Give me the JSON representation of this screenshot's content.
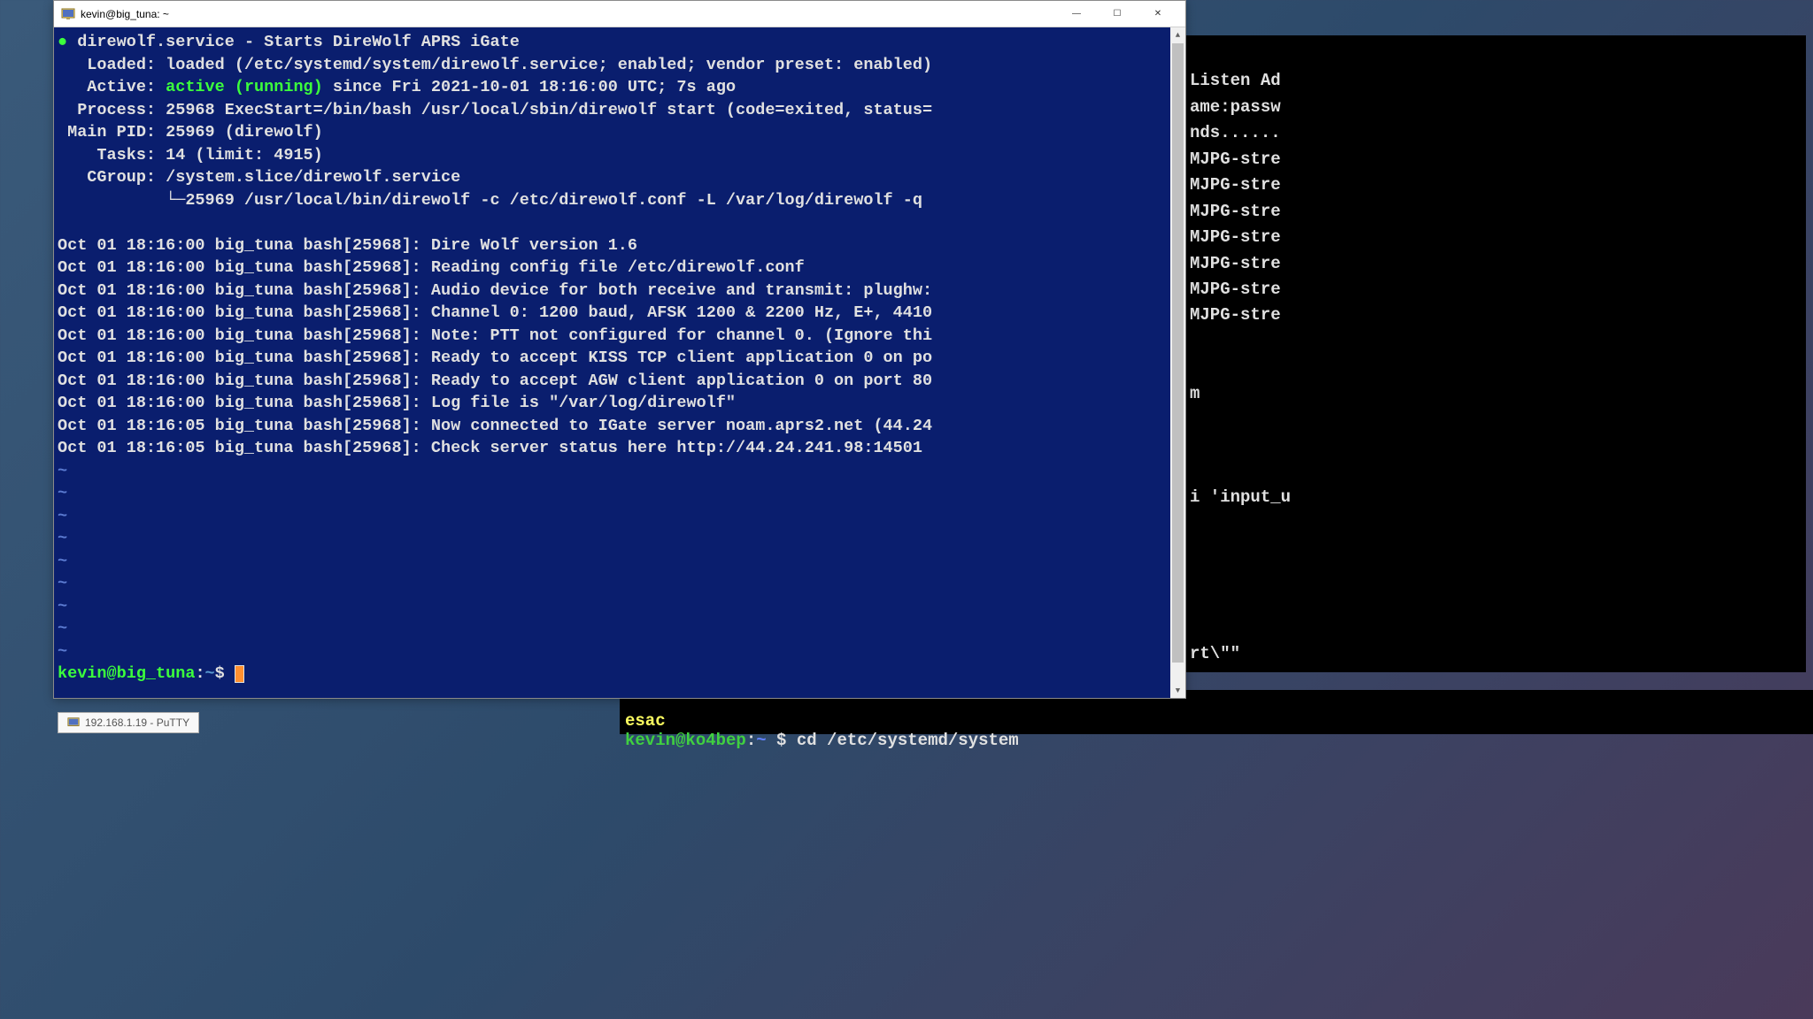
{
  "window": {
    "title": "kevin@big_tuna: ~",
    "minimize": "—",
    "maximize": "☐",
    "close": "✕"
  },
  "taskbar": {
    "item1": "192.168.1.19 - PuTTY"
  },
  "terminal": {
    "l1a": "● ",
    "l1b": "direwolf.service - Starts DireWolf APRS iGate",
    "l2": "   Loaded: loaded (/etc/systemd/system/direwolf.service; enabled; vendor preset: enabled)",
    "l3a": "   Active: ",
    "l3b": "active (running)",
    "l3c": " since Fri 2021-10-01 18:16:00 UTC; 7s ago",
    "l4": "  Process: 25968 ExecStart=/bin/bash /usr/local/sbin/direwolf start (code=exited, status=",
    "l5": " Main PID: 25969 (direwolf)",
    "l6": "    Tasks: 14 (limit: 4915)",
    "l7": "   CGroup: /system.slice/direwolf.service",
    "l8": "           └─25969 /usr/local/bin/direwolf -c /etc/direwolf.conf -L /var/log/direwolf -q",
    "l9": "",
    "l10": "Oct 01 18:16:00 big_tuna bash[25968]: Dire Wolf version 1.6",
    "l11": "Oct 01 18:16:00 big_tuna bash[25968]: Reading config file /etc/direwolf.conf",
    "l12": "Oct 01 18:16:00 big_tuna bash[25968]: Audio device for both receive and transmit: plughw:",
    "l13": "Oct 01 18:16:00 big_tuna bash[25968]: Channel 0: 1200 baud, AFSK 1200 & 2200 Hz, E+, 4410",
    "l14": "Oct 01 18:16:00 big_tuna bash[25968]: Note: PTT not configured for channel 0. (Ignore thi",
    "l15": "Oct 01 18:16:00 big_tuna bash[25968]: Ready to accept KISS TCP client application 0 on po",
    "l16": "Oct 01 18:16:00 big_tuna bash[25968]: Ready to accept AGW client application 0 on port 80",
    "l17": "Oct 01 18:16:00 big_tuna bash[25968]: Log file is \"/var/log/direwolf\"",
    "l18": "Oct 01 18:16:05 big_tuna bash[25968]: Now connected to IGate server noam.aprs2.net (44.24",
    "l19": "Oct 01 18:16:05 big_tuna bash[25968]: Check server status here http://44.24.241.98:14501",
    "tilde": "~",
    "prompt_user": "kevin@big_tuna",
    "prompt_sep": ":",
    "prompt_path": "~",
    "prompt_dollar": "$ "
  },
  "bgterm": {
    "l1": "Listen Ad",
    "l2": "ame:passw",
    "l3": "nds......",
    "l4": "MJPG-stre",
    "l5": "MJPG-stre",
    "l6": "MJPG-stre",
    "l7": "MJPG-stre",
    "l8": "MJPG-stre",
    "l9": "MJPG-stre",
    "l10": "MJPG-stre",
    "blank": "",
    "lm": "m",
    "input": "i 'input_u",
    "rt": "rt\\\"\""
  },
  "bgterm2": {
    "l1": "esac",
    "l2a": "kevin@ko4bep",
    "l2b": ":",
    "l2c": "~",
    "l2d": " $ cd /etc/systemd/system"
  }
}
